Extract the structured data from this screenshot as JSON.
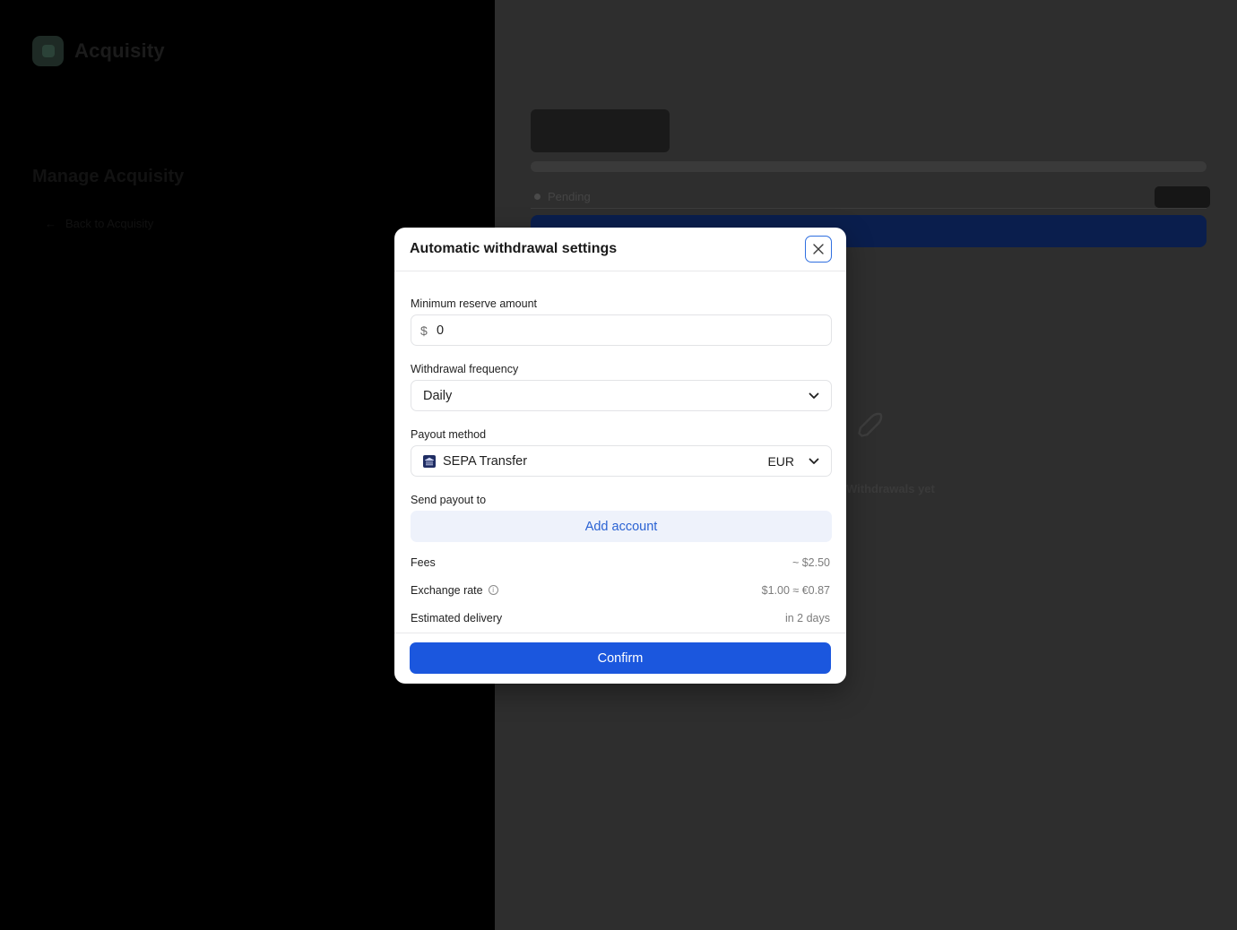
{
  "sidebar": {
    "logo_text": "Acquisity",
    "title": "Manage Acquisity",
    "back_link": "Back to Acquisity"
  },
  "main": {
    "pending_label": "Pending",
    "empty_title": "Withdrawals yet"
  },
  "modal": {
    "title": "Automatic withdrawal settings",
    "reserve": {
      "label": "Minimum reserve amount",
      "currency_symbol": "$",
      "value": "0"
    },
    "frequency": {
      "label": "Withdrawal frequency",
      "selected": "Daily"
    },
    "payout_method": {
      "label": "Payout method",
      "selected": "SEPA Transfer",
      "currency": "EUR"
    },
    "send_to": {
      "label": "Send payout to",
      "button": "Add account"
    },
    "details": [
      {
        "label": "Fees",
        "value": "~ $2.50",
        "info": false
      },
      {
        "label": "Exchange rate",
        "value": "$1.00 ≈ €0.87",
        "info": true
      },
      {
        "label": "Estimated delivery",
        "value": "in 2 days",
        "info": false
      }
    ],
    "confirm_label": "Confirm"
  },
  "colors": {
    "primary": "#1b57de",
    "link": "#2a62d3",
    "overlay_main": "#2e2e2e",
    "overlay_sidebar": "#000000"
  }
}
